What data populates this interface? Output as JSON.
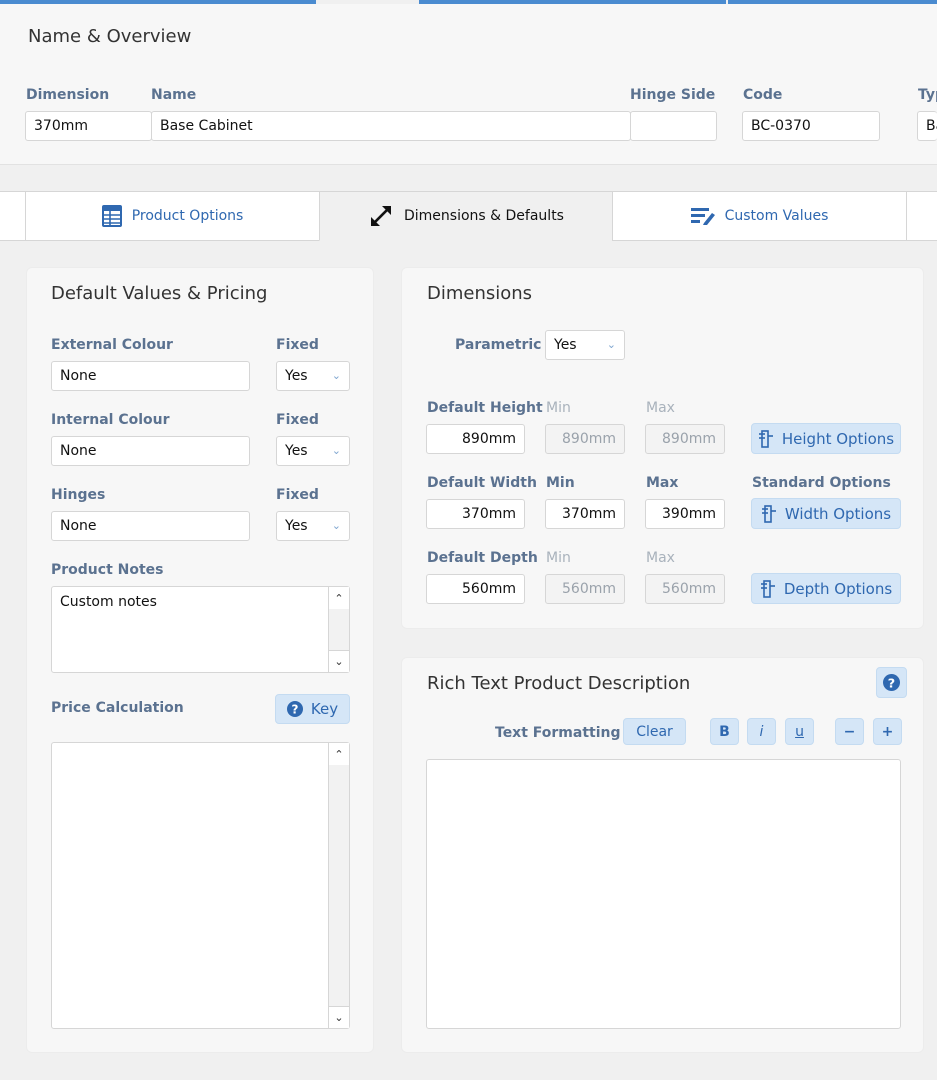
{
  "overview": {
    "title": "Name & Overview",
    "fields": {
      "dimension": {
        "label": "Dimension",
        "value": "370mm"
      },
      "name": {
        "label": "Name",
        "value": "Base Cabinet"
      },
      "hinge_side": {
        "label": "Hinge Side",
        "value": ""
      },
      "code": {
        "label": "Code",
        "value": "BC-0370"
      },
      "type": {
        "label": "Typ",
        "value": "Ba"
      }
    }
  },
  "tabs": {
    "product_options": "Product Options",
    "dimensions_defaults": "Dimensions & Defaults",
    "custom_values": "Custom Values"
  },
  "defaults_panel": {
    "title": "Default Values & Pricing",
    "fixed_label": "Fixed",
    "external_colour": {
      "label": "External Colour",
      "value": "None",
      "fixed": "Yes"
    },
    "internal_colour": {
      "label": "Internal Colour",
      "value": "None",
      "fixed": "Yes"
    },
    "hinges": {
      "label": "Hinges",
      "value": "None",
      "fixed": "Yes"
    },
    "product_notes": {
      "label": "Product Notes",
      "value": "Custom notes"
    },
    "price_calculation": {
      "label": "Price Calculation",
      "key_button": "Key"
    }
  },
  "dimensions_panel": {
    "title": "Dimensions",
    "parametric": {
      "label": "Parametric",
      "value": "Yes"
    },
    "min_label": "Min",
    "max_label": "Max",
    "standard_options_label": "Standard Options",
    "height": {
      "label": "Default Height",
      "value": "890mm",
      "min": "890mm",
      "max": "890mm",
      "button": "Height Options"
    },
    "width": {
      "label": "Default Width",
      "value": "370mm",
      "min": "370mm",
      "max": "390mm",
      "button": "Width Options"
    },
    "depth": {
      "label": "Default Depth",
      "value": "560mm",
      "min": "560mm",
      "max": "560mm",
      "button": "Depth Options"
    }
  },
  "rich_text": {
    "title": "Rich Text Product Description",
    "formatting_label": "Text Formatting",
    "clear": "Clear",
    "bold": "B",
    "italic": "i",
    "underline": "u",
    "minus": "−",
    "plus": "+",
    "help": "?"
  },
  "colors": {
    "accent": "#2f68b0",
    "button_bg": "#d5e6f7",
    "progress": "#4a8bd0"
  }
}
